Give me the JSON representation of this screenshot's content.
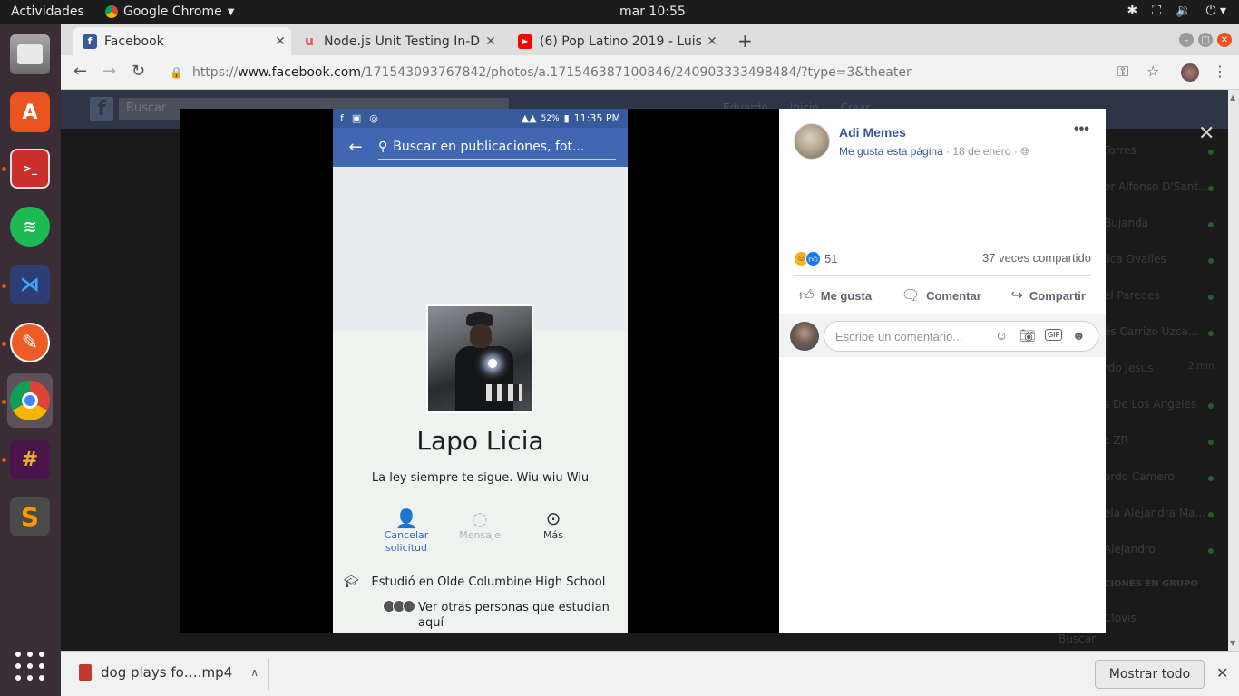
{
  "topbar": {
    "activities": "Actividades",
    "app_name": "Google Chrome",
    "clock": "mar 10:55"
  },
  "dock": {
    "apps": [
      "files-icon",
      "software-center-icon",
      "terminal-icon",
      "spotify-icon",
      "vscode-icon",
      "postman-icon",
      "chrome-icon",
      "slack-icon",
      "sublime-text-icon"
    ]
  },
  "tabs": [
    {
      "title": "Facebook",
      "favicon": "f",
      "color": "#3b5998"
    },
    {
      "title": "Node.js Unit Testing In-De",
      "favicon": "u",
      "color": "#ec5252"
    },
    {
      "title": "(6) Pop Latino 2019 - Luis",
      "favicon": "▶",
      "color": "#ff0000"
    }
  ],
  "address": {
    "scheme": "https://",
    "domain": "www.facebook.com",
    "path": "/171543093767842/photos/a.171546387100846/240903333498484/?type=3&theater"
  },
  "fb_bg": {
    "search_placeholder": "Buscar",
    "nav": [
      "Eduardo",
      "Inicio",
      "Crear"
    ],
    "chat_names": [
      "Torres",
      "er Alfonso D'Sant...",
      "Bujanda",
      "lica Ovalles",
      "el Paredes",
      "és Carrizo Uzca...",
      "rdo Jesus",
      "s De Los Angeles",
      "c ZR",
      "ardo Camero",
      "ela Alejandra Ma...",
      "Alejandro",
      "CIONES EN GRUPO",
      "Clovis"
    ],
    "chat_time": "2 min",
    "chat_search": "Buscar"
  },
  "screenshot": {
    "time": "11:35 PM",
    "battery": "52%",
    "search_placeholder": "Buscar en publicaciones, fot...",
    "profile_name": "Lapo Licia",
    "bio": "La ley siempre te sigue. Wiu wiu Wiu",
    "actions": [
      {
        "label": "Cancelar solicitud",
        "icon": "person-add-icon"
      },
      {
        "label": "Mensaje",
        "icon": "messenger-icon"
      },
      {
        "label": "Más",
        "icon": "more-icon"
      }
    ],
    "education_prefix": "Estudió en",
    "education_school": "Olde Columbine High School",
    "others": "Ver otras personas que estudian aquí"
  },
  "post": {
    "page_name": "Adi Memes",
    "like_page": "Me gusta esta página",
    "date": "18 de enero",
    "reaction_count": "51",
    "shares": "37 veces compartido",
    "like_label": "Me gusta",
    "comment_label": "Comentar",
    "share_label": "Compartir",
    "comment_placeholder": "Escribe un comentario..."
  },
  "downloads": {
    "filename": "dog plays fo….mp4",
    "show_all": "Mostrar todo"
  },
  "colors": {
    "fb_blue": "#4267b2",
    "link_blue": "#365899",
    "ubuntu_orange": "#e95420"
  }
}
